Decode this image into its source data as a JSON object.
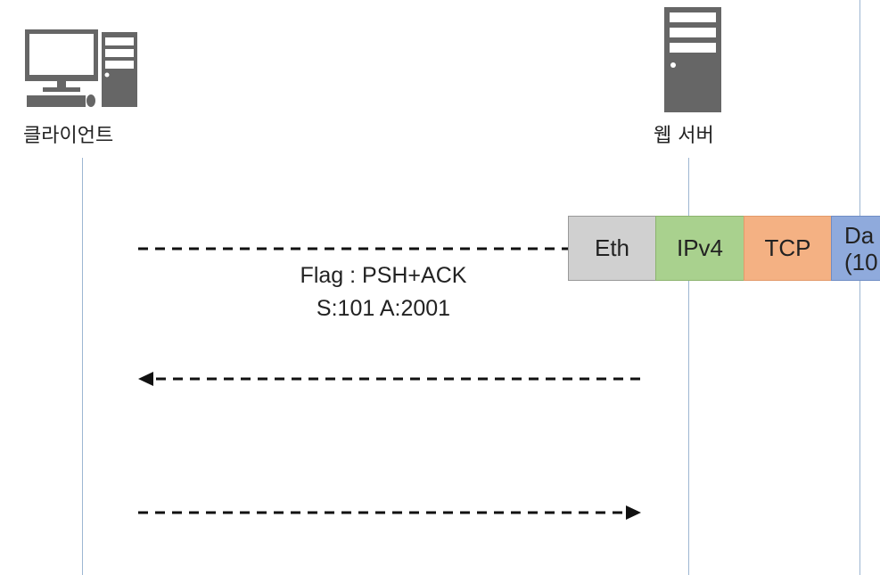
{
  "client": {
    "label": "클라이언트",
    "icon": "desktop-computer-icon"
  },
  "server": {
    "label": "웹 서버",
    "icon": "server-tower-icon"
  },
  "packet": {
    "segments": [
      {
        "label": "Eth",
        "color": "#d0d0d0"
      },
      {
        "label": "IPv4",
        "color": "#a9d18e"
      },
      {
        "label": "TCP",
        "color": "#f4b183"
      },
      {
        "label": "Da",
        "label2": "(10",
        "color": "#8faadc"
      }
    ]
  },
  "message": {
    "flag": "Flag : PSH+ACK",
    "seq_ack": "S:101 A:2001"
  }
}
